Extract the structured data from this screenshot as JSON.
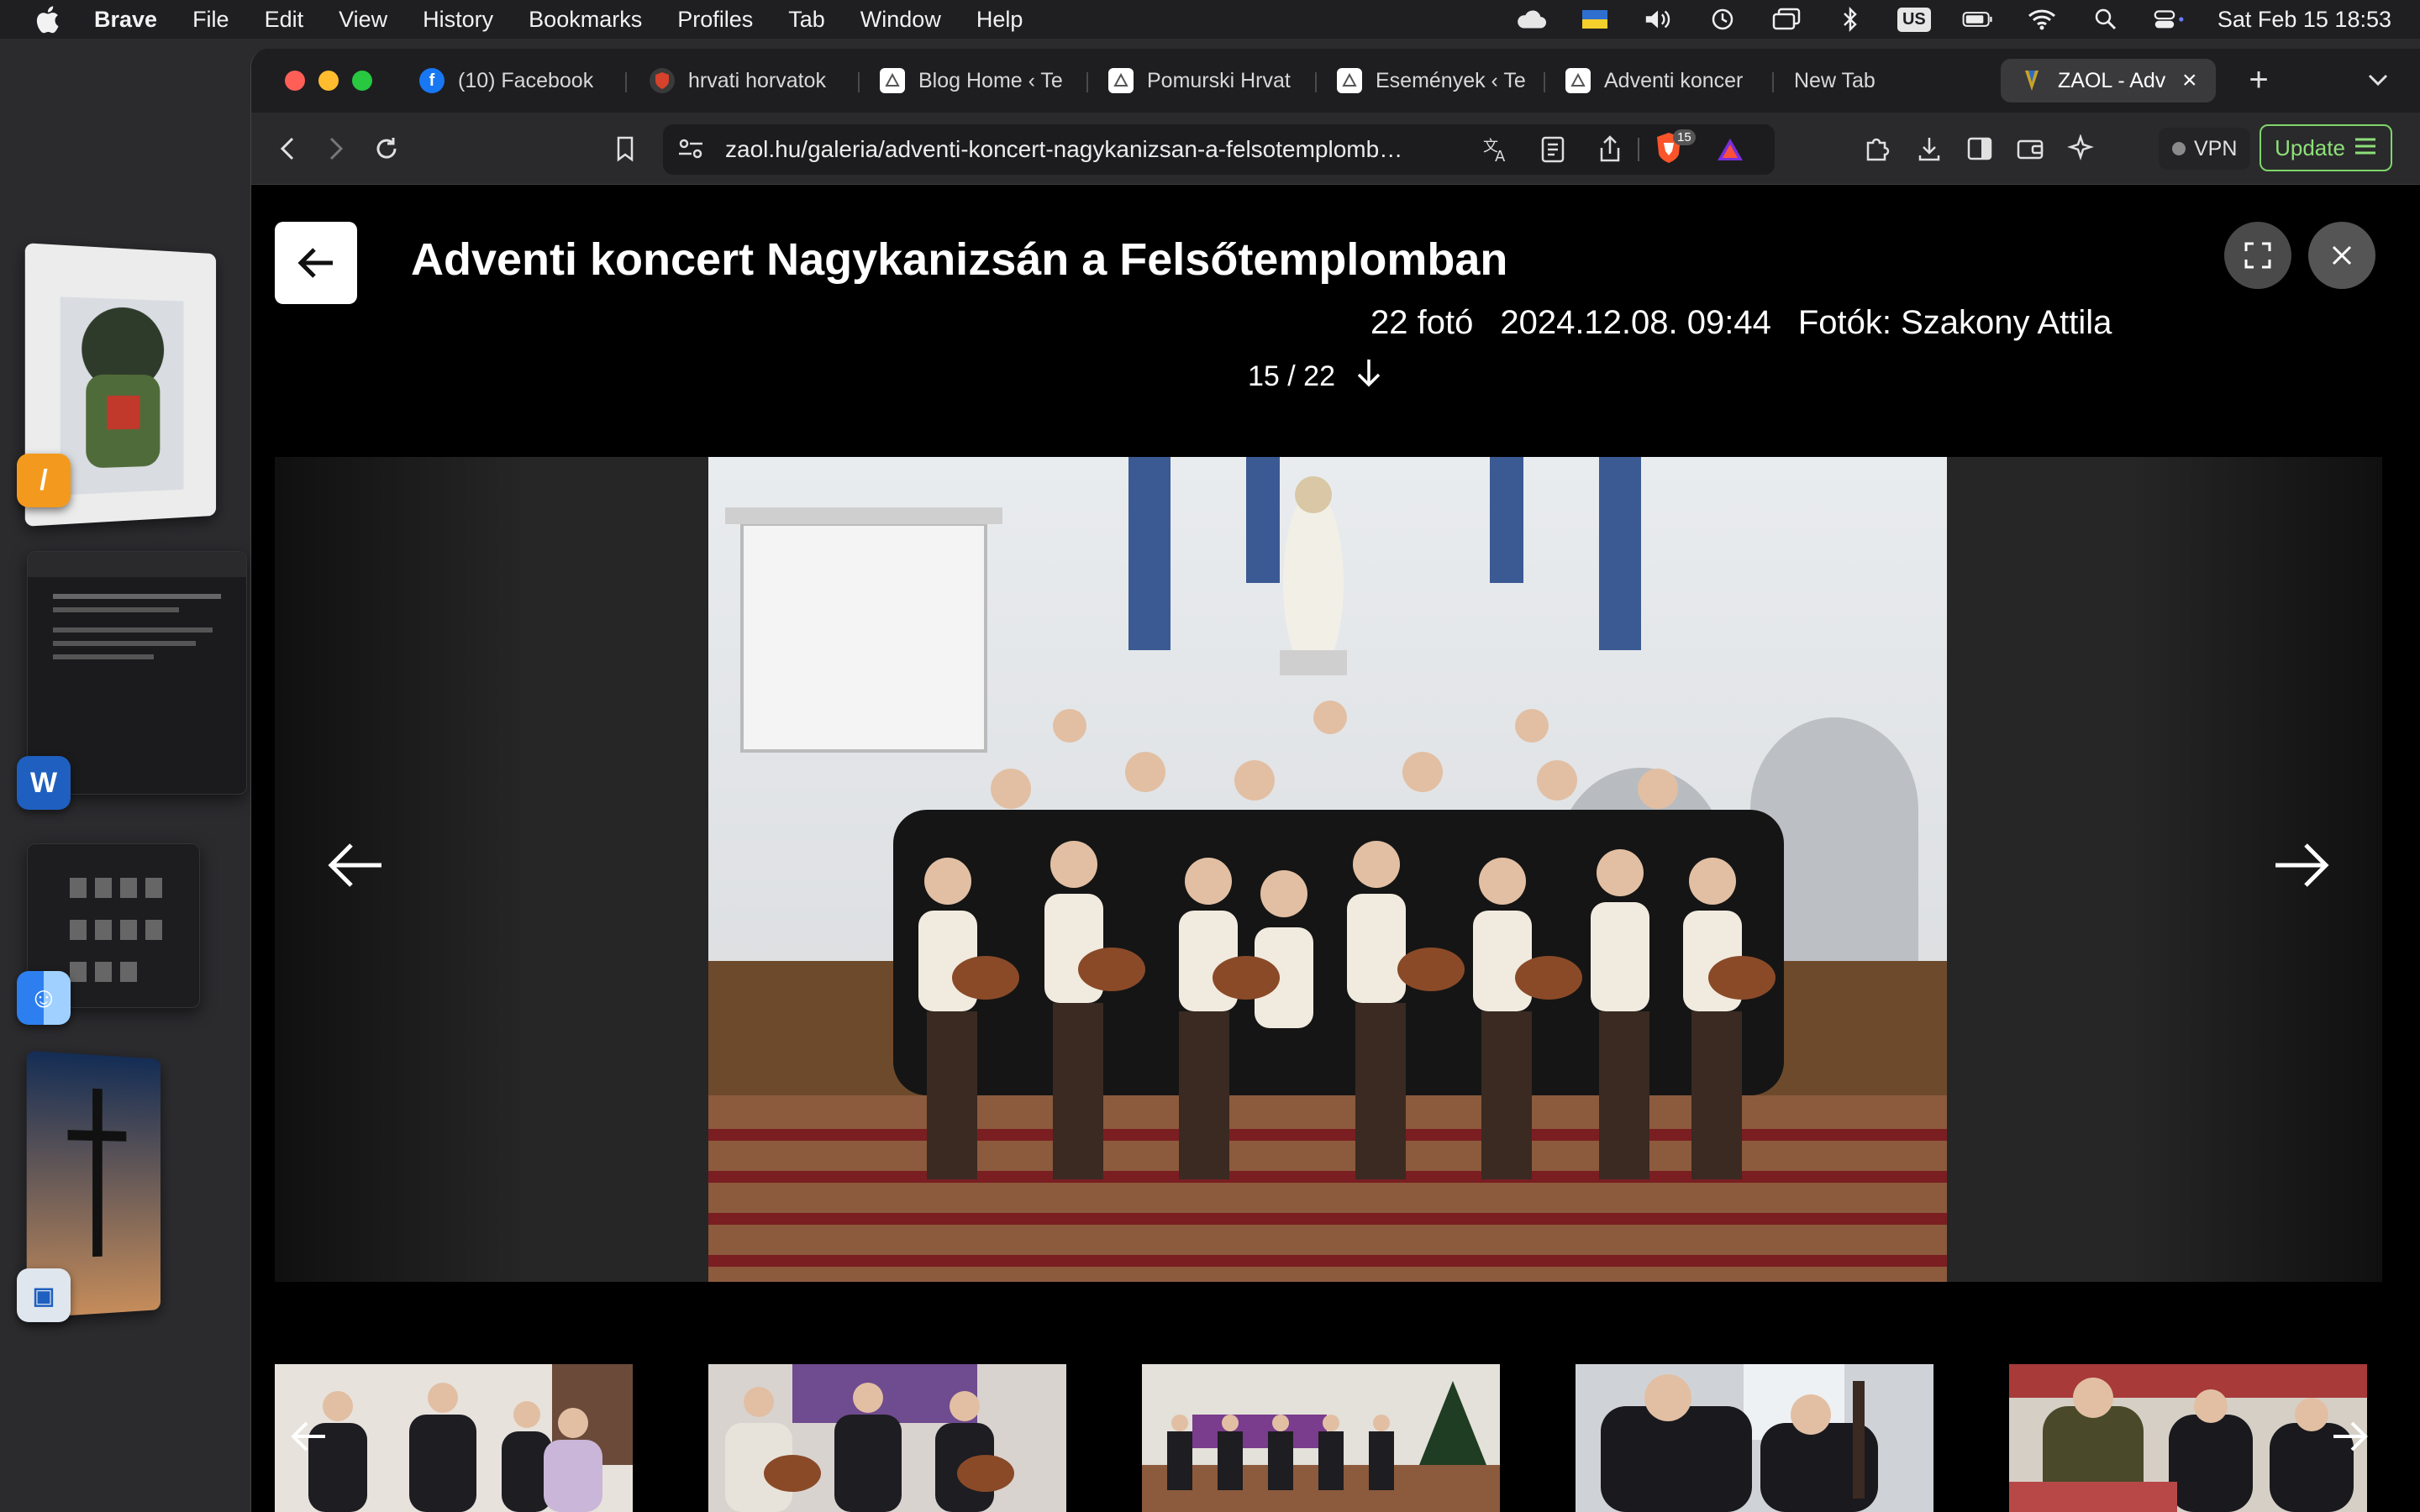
{
  "menubar": {
    "app_name": "Brave",
    "items": [
      "File",
      "Edit",
      "View",
      "History",
      "Bookmarks",
      "Profiles",
      "Tab",
      "Window",
      "Help"
    ],
    "input_source": "US",
    "clock": "Sat Feb 15  18:53"
  },
  "tabs": [
    {
      "label": "(10) Facebook",
      "icon": "facebook-icon"
    },
    {
      "label": "hrvati horvatok",
      "icon": "shield-icon"
    },
    {
      "label": "Blog Home ‹ Te",
      "icon": "site-icon"
    },
    {
      "label": "Pomurski Hrvat",
      "icon": "site-icon"
    },
    {
      "label": "Események ‹ Te",
      "icon": "site-icon"
    },
    {
      "label": "Adventi koncer",
      "icon": "site-icon"
    },
    {
      "label": "New Tab",
      "icon": ""
    },
    {
      "label": "ZAOL - Adv",
      "icon": "zaol-icon"
    }
  ],
  "toolbar": {
    "url": "zaol.hu/galeria/adventi-koncert-nagykanizsan-a-felsotemplomb…",
    "shields_count": "15",
    "vpn_label": "VPN",
    "update_label": "Update"
  },
  "gallery": {
    "title": "Adventi koncert Nagykanizsán a Felsőtemplomban",
    "photo_count": "22 fotó",
    "date": "2024.12.08. 09:44",
    "credit": "Fotók: Szakony Attila",
    "position": "15 / 22"
  },
  "colors": {
    "menubar_bg": "#1f1f22",
    "page_bg": "#000000",
    "update_accent": "#7ed56b",
    "traffic_red": "#ff5f57",
    "traffic_yellow": "#febc2e",
    "traffic_green": "#28c840"
  }
}
